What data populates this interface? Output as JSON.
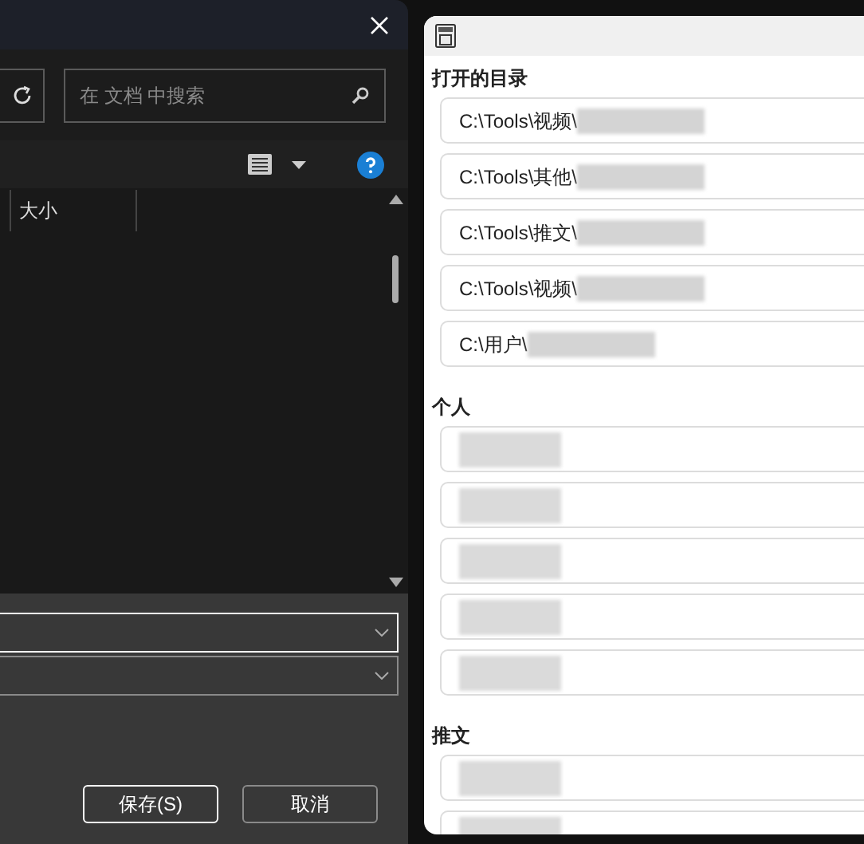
{
  "save_dialog": {
    "search": {
      "placeholder": "在 文档 中搜索"
    },
    "columns": [
      "大小"
    ],
    "dropdowns": [
      {
        "focused": true
      },
      {
        "focused": false
      }
    ],
    "buttons": [
      {
        "label": "保存(S)",
        "default": true
      },
      {
        "label": "取消",
        "default": false
      }
    ]
  },
  "popup": {
    "sections": [
      {
        "title": "打开的目录",
        "items": [
          {
            "text": "C:\\Tools\\视频\\",
            "redacted": true
          },
          {
            "text": "C:\\Tools\\其他\\",
            "redacted": true
          },
          {
            "text": "C:\\Tools\\推文\\",
            "redacted": true
          },
          {
            "text": "C:\\Tools\\视频\\",
            "redacted": true
          },
          {
            "text": "C:\\用户\\",
            "redacted": true
          }
        ]
      },
      {
        "title": "个人",
        "items": [
          {
            "redacted": true
          },
          {
            "redacted": true
          },
          {
            "redacted": true
          },
          {
            "redacted": true
          },
          {
            "redacted": true
          }
        ]
      },
      {
        "title": "推文",
        "items": [
          {
            "redacted": true
          },
          {
            "redacted": true
          }
        ]
      }
    ]
  }
}
